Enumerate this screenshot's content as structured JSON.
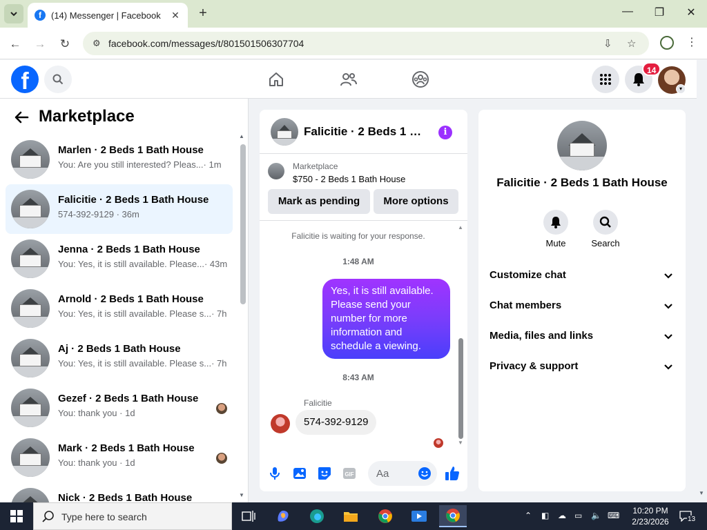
{
  "browser": {
    "tab_title": "(14) Messenger | Facebook",
    "new_tab": "+",
    "url": "facebook.com/messages/t/801501506307704"
  },
  "header": {
    "notification_count": "14"
  },
  "sidebar": {
    "title": "Marketplace",
    "conversations": [
      {
        "name": "Marlen · 2 Beds 1 Bath House",
        "snippet": "You: Are you still interested? Pleas...",
        "time": "· 1m",
        "active": false,
        "read": false
      },
      {
        "name": "Falicitie · 2 Beds 1 Bath House",
        "snippet": "574-392-9129 · 36m",
        "time": "",
        "active": true,
        "read": false
      },
      {
        "name": "Jenna · 2 Beds 1 Bath House",
        "snippet": "You: Yes, it is still available. Please...",
        "time": "· 43m",
        "active": false,
        "read": false
      },
      {
        "name": "Arnold · 2 Beds 1 Bath House",
        "snippet": "You: Yes, it is still available. Please s...",
        "time": "· 7h",
        "active": false,
        "read": false
      },
      {
        "name": "Aj · 2 Beds 1 Bath House",
        "snippet": "You: Yes, it is still available. Please s...",
        "time": "· 7h",
        "active": false,
        "read": false
      },
      {
        "name": "Gezef · 2 Beds 1 Bath House",
        "snippet": "You: thank you · 1d",
        "time": "",
        "active": false,
        "read": true
      },
      {
        "name": "Mark · 2 Beds 1 Bath House",
        "snippet": "You: thank you · 1d",
        "time": "",
        "active": false,
        "read": true
      },
      {
        "name": "Nick · 2 Beds 1 Bath House",
        "snippet": "",
        "time": "",
        "active": false,
        "read": false
      }
    ]
  },
  "chat": {
    "title": "Falicitie · 2 Beds 1 Ba...",
    "listing_source": "Marketplace",
    "listing_price": "$750 - 2 Beds 1 Bath House",
    "mark_pending": "Mark as pending",
    "more_options": "More options",
    "waiting_note": "Falicitie is waiting for your response.",
    "time1": "1:48 AM",
    "outgoing_message": "Yes, it is still available. Please send your number for more information and schedule a  viewing.",
    "time2": "8:43 AM",
    "sender_name": "Falicitie",
    "incoming_message": "574-392-9129",
    "composer_placeholder": "Aa"
  },
  "details": {
    "title": "Falicitie · 2 Beds 1 Bath House",
    "mute_label": "Mute",
    "search_label": "Search",
    "sections": [
      "Customize chat",
      "Chat members",
      "Media, files and links",
      "Privacy & support"
    ]
  },
  "taskbar": {
    "search_placeholder": "Type here to search",
    "time": "10:20 PM",
    "date": "2/23/2026",
    "notifications": "13"
  }
}
